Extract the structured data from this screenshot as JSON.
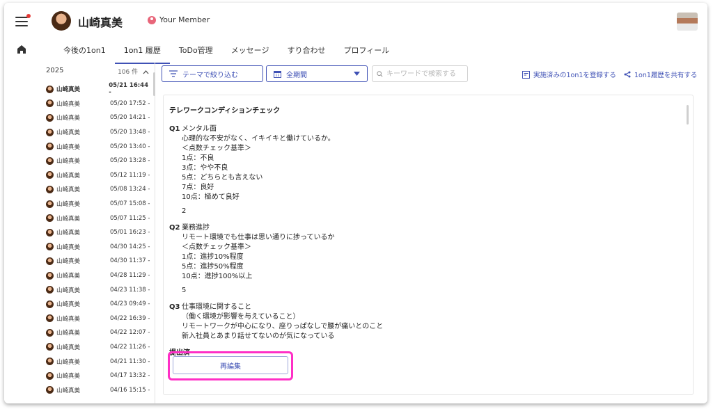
{
  "header": {
    "user_name": "山崎真美",
    "member_label": "Your Member"
  },
  "tabs": [
    {
      "label": "今後の1on1",
      "active": false
    },
    {
      "label": "1on1 履歴",
      "active": true
    },
    {
      "label": "ToDo管理",
      "active": false
    },
    {
      "label": "メッセージ",
      "active": false
    },
    {
      "label": "すり合わせ",
      "active": false
    },
    {
      "label": "プロフィール",
      "active": false
    }
  ],
  "history": {
    "year": "2025",
    "count": "106 件",
    "items": [
      {
        "name": "山崎真美",
        "date": "05/21 16:44 -",
        "active": true
      },
      {
        "name": "山崎真美",
        "date": "05/20 17:52 -"
      },
      {
        "name": "山崎真美",
        "date": "05/20 14:21 -"
      },
      {
        "name": "山崎真美",
        "date": "05/20 13:48 -"
      },
      {
        "name": "山崎真美",
        "date": "05/20 13:40 -"
      },
      {
        "name": "山崎真美",
        "date": "05/20 13:28 -"
      },
      {
        "name": "山崎真美",
        "date": "05/12 11:19 -"
      },
      {
        "name": "山崎真美",
        "date": "05/08 13:24 -"
      },
      {
        "name": "山崎真美",
        "date": "05/07 15:08 -"
      },
      {
        "name": "山崎真美",
        "date": "05/07 11:25 -"
      },
      {
        "name": "山崎真美",
        "date": "05/01 16:23 -"
      },
      {
        "name": "山崎真美",
        "date": "04/30 14:25 -"
      },
      {
        "name": "山崎真美",
        "date": "04/30 11:37 -"
      },
      {
        "name": "山崎真美",
        "date": "04/28 11:29 -"
      },
      {
        "name": "山崎真美",
        "date": "04/23 11:38 -"
      },
      {
        "name": "山崎真美",
        "date": "04/23 09:49 -"
      },
      {
        "name": "山崎真美",
        "date": "04/22 16:39 -"
      },
      {
        "name": "山崎真美",
        "date": "04/22 12:07 -"
      },
      {
        "name": "山崎真美",
        "date": "04/22 11:26 -"
      },
      {
        "name": "山崎真美",
        "date": "04/21 11:30 -"
      },
      {
        "name": "山崎真美",
        "date": "04/17 13:32 -"
      },
      {
        "name": "山崎真美",
        "date": "04/16 15:15 -"
      }
    ]
  },
  "toolbar": {
    "filter_label": "テーマで絞り込む",
    "period_label": "全期間",
    "search_placeholder": "キーワードで検索する",
    "register_label": "実施済みの1on1を登録する",
    "share_label": "1on1履歴を共有する"
  },
  "content": {
    "title": "テレワークコンディションチェック",
    "questions": [
      {
        "no": "Q1",
        "heading": "メンタル面",
        "lines": [
          "心理的な不安がなく、イキイキと働けているか。",
          "＜点数チェック基準＞",
          "1点：不良",
          "3点：やや不良",
          "5点：どちらとも言えない",
          "7点：良好",
          "10点：極めて良好"
        ],
        "answer": "2"
      },
      {
        "no": "Q2",
        "heading": "業務進捗",
        "lines": [
          "リモート環境でも仕事は思い通りに捗っているか",
          "＜点数チェック基準＞",
          "1点：進捗10%程度",
          "5点：進捗50%程度",
          "10点：進捗100%以上"
        ],
        "answer": "5"
      },
      {
        "no": "Q3",
        "heading": "仕事環境に関すること",
        "lines": [
          "（働く環境が影響を与えていること）"
        ],
        "answer_lines": [
          "リモートワークが中心になり、座りっぱなしで腰が痛いとのこと",
          "新入社員とあまり話せてないのが気になっている"
        ]
      }
    ],
    "status": "提出済",
    "reedit_label": "再編集"
  },
  "colors": {
    "accent": "#3f51b5",
    "highlight": "#ff2fc6",
    "notification": "#e53935"
  }
}
